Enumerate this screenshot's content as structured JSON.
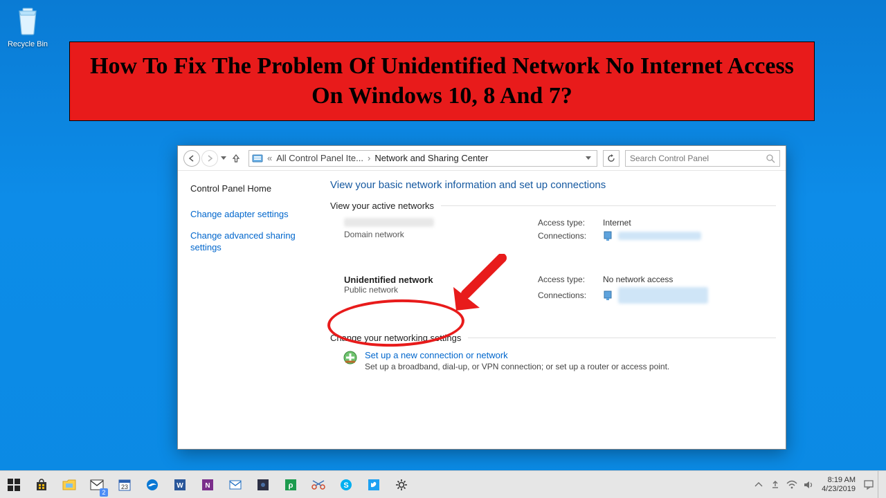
{
  "desktop": {
    "recycle_bin": "Recycle Bin"
  },
  "banner": {
    "title": "How To Fix The Problem Of Unidentified Network No Internet Access On Windows 10, 8 And 7?"
  },
  "addr": {
    "crumb1": "All Control Panel Ite...",
    "crumb2": "Network and Sharing Center"
  },
  "search": {
    "placeholder": "Search Control Panel"
  },
  "sidebar": {
    "home": "Control Panel Home",
    "links": {
      "adapter": "Change adapter settings",
      "advanced": "Change advanced sharing settings"
    }
  },
  "main": {
    "heading": "View your basic network information and set up connections",
    "active_title": "View your active networks",
    "net1": {
      "type": "Domain network",
      "access_lbl": "Access type:",
      "access_val": "Internet",
      "conn_lbl": "Connections:"
    },
    "net2": {
      "name": "Unidentified network",
      "type": "Public network",
      "access_lbl": "Access type:",
      "access_val": "No network access",
      "conn_lbl": "Connections:"
    },
    "change_title": "Change your networking settings",
    "setup_link": "Set up a new connection or network",
    "setup_desc": "Set up a broadband, dial-up, or VPN connection; or set up a router or access point."
  },
  "taskbar": {
    "badge": "2",
    "time": "8:19 AM",
    "date": "4/23/2019"
  }
}
